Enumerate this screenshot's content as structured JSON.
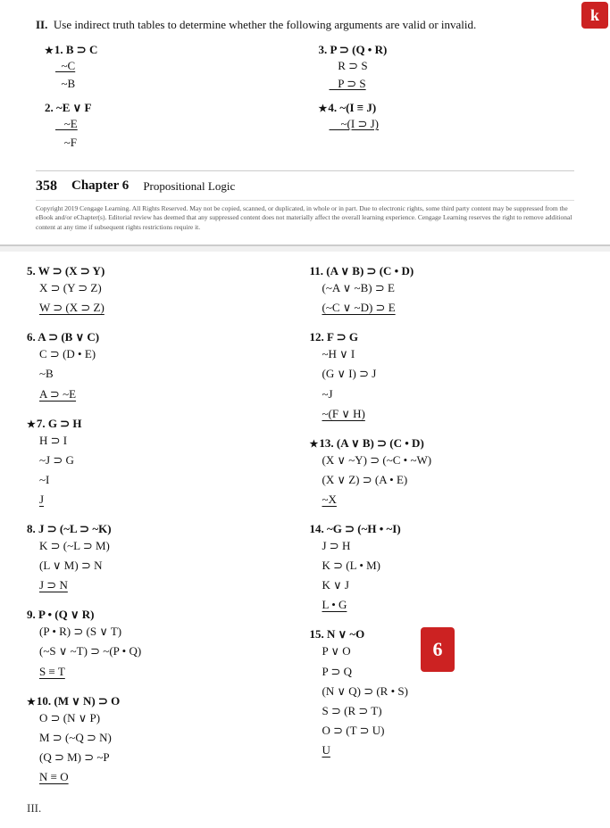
{
  "top_badge": "k",
  "instructions": {
    "label": "II.",
    "text": "Use indirect truth tables to determine whether the following arguments are valid or invalid."
  },
  "top_problems": {
    "left": [
      {
        "id": "1",
        "starred": true,
        "lines": [
          "B ⊃ C",
          "~C",
          "~B"
        ]
      },
      {
        "id": "2",
        "starred": false,
        "lines": [
          "~E ∨ F",
          "~E",
          "~F"
        ]
      }
    ],
    "right": [
      {
        "id": "3",
        "starred": false,
        "lines": [
          "P ⊃ (Q • R)",
          "R ⊃ S",
          "P ⊃ S"
        ]
      },
      {
        "id": "4",
        "starred": true,
        "lines": [
          "~(I ≡ J)",
          "~(I ⊃ J)"
        ]
      }
    ]
  },
  "footer": {
    "page_num": "358",
    "chapter": "Chapter 6",
    "subject": "Propositional Logic"
  },
  "copyright": "Copyright 2019 Cengage Learning. All Rights Reserved. May not be copied, scanned, or duplicated, in whole or in part. Due to electronic rights, some third party content may be suppressed from the eBook and/or eChapter(s). Editorial review has deemed that any suppressed content does not materially affect the overall learning experience. Cengage Learning reserves the right to remove additional content at any time if subsequent rights restrictions require it.",
  "bottom_badge": "6",
  "bottom_problems": {
    "left": [
      {
        "id": "5",
        "starred": false,
        "lines": [
          "W ⊃ (X ⊃ Y)",
          "X ⊃ (Y ⊃ Z)",
          "W ⊃ (X ⊃ Z)"
        ]
      },
      {
        "id": "6",
        "starred": false,
        "lines": [
          "A ⊃ (B ∨ C)",
          "C ⊃ (D • E)",
          "~B",
          "A ⊃ ~E"
        ]
      },
      {
        "id": "7",
        "starred": true,
        "lines": [
          "G ⊃ H",
          "H ⊃ I",
          "~J ⊃ G",
          "~I",
          "J"
        ]
      },
      {
        "id": "8",
        "starred": false,
        "lines": [
          "J ⊃ (~L ⊃ ~K)",
          "K ⊃ (~L ⊃ M)",
          "(L ∨ M) ⊃ N",
          "J ⊃ N"
        ]
      },
      {
        "id": "9",
        "starred": false,
        "lines": [
          "P • (Q ∨ R)",
          "(P • R) ⊃ (S ∨ T)",
          "(~S ∨ ~T) ⊃ ~(P • Q)",
          "S ≡ T"
        ]
      },
      {
        "id": "10",
        "starred": true,
        "lines": [
          "(M ∨ N) ⊃ O",
          "O ⊃ (N ∨ P)",
          "M ⊃ (~Q ⊃ N)",
          "(Q ⊃ M) ⊃ ~P",
          "N ≡ O"
        ]
      }
    ],
    "right": [
      {
        "id": "11",
        "starred": false,
        "lines": [
          "(A ∨ B) ⊃ (C • D)",
          "(~A ∨ ~B) ⊃ E",
          "(~C ∨ ~D) ⊃ E"
        ]
      },
      {
        "id": "12",
        "starred": false,
        "lines": [
          "F ⊃ G",
          "~H ∨ I",
          "(G ∨ I) ⊃ J",
          "~J",
          "~(F ∨ H)"
        ]
      },
      {
        "id": "13",
        "starred": true,
        "lines": [
          "(A ∨ B) ⊃ (C • D)",
          "(X ∨ ~Y) ⊃ (~C • ~W)",
          "(X ∨ Z) ⊃ (A • E)",
          "~X"
        ]
      },
      {
        "id": "14",
        "starred": false,
        "lines": [
          "~G ⊃ (~H • ~I)",
          "J ⊃ H",
          "K ⊃ (L • M)",
          "K ∨ J",
          "L • G"
        ]
      },
      {
        "id": "15",
        "starred": false,
        "lines": [
          "N ∨ ~O",
          "P ∨ O",
          "P ⊃ Q",
          "(N ∨ Q) ⊃ (R • S)",
          "S ⊃ (R ⊃ T)",
          "O ⊃ (T ⊃ U)",
          "U"
        ]
      }
    ]
  },
  "section_iii_label": "III."
}
